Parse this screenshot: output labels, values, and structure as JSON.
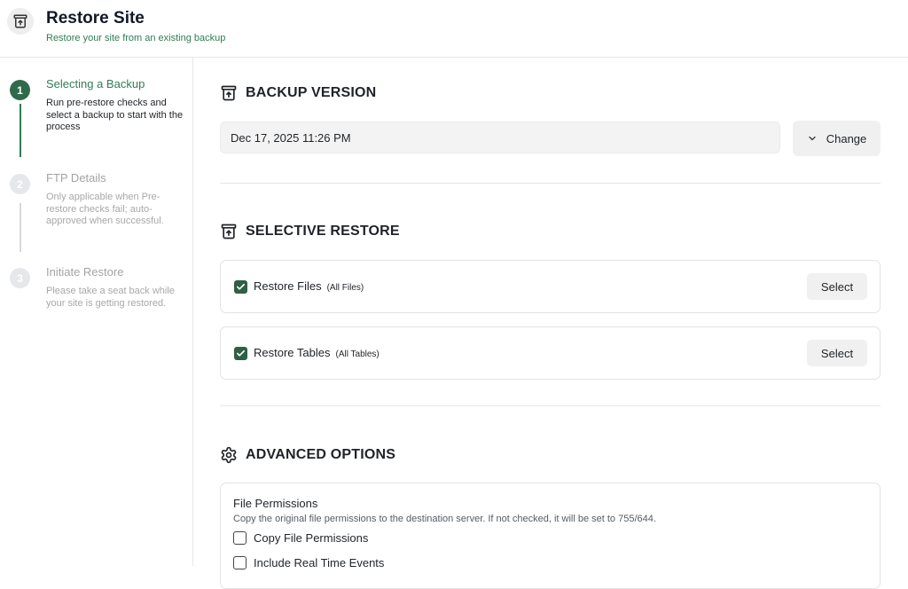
{
  "header": {
    "title": "Restore Site",
    "subtitle": "Restore your site from an existing backup",
    "icon": "archive-restore-icon"
  },
  "steps": [
    {
      "number": "1",
      "title": "Selecting a Backup",
      "description": "Run pre-restore checks and select a backup to start with the process",
      "state": "active"
    },
    {
      "number": "2",
      "title": "FTP Details",
      "description": "Only applicable when Pre-restore checks fail; auto-approved when successful.",
      "state": "inactive"
    },
    {
      "number": "3",
      "title": "Initiate Restore",
      "description": "Please take a seat back while your site is getting restored.",
      "state": "inactive"
    }
  ],
  "backup_version": {
    "heading": "BACKUP VERSION",
    "value": "Dec 17, 2025 11:26 PM",
    "change_label": "Change"
  },
  "selective_restore": {
    "heading": "SELECTIVE RESTORE",
    "items": [
      {
        "label": "Restore Files",
        "sub": "(All Files)",
        "checked": true,
        "button": "Select"
      },
      {
        "label": "Restore Tables",
        "sub": "(All Tables)",
        "checked": true,
        "button": "Select"
      }
    ]
  },
  "advanced_options": {
    "heading": "ADVANCED OPTIONS",
    "file_permissions": {
      "title": "File Permissions",
      "description": "Copy the original file permissions to the destination server. If not checked, it will be set to 755/644.",
      "options": [
        {
          "label": "Copy File Permissions",
          "checked": false
        },
        {
          "label": "Include Real Time Events",
          "checked": false
        }
      ]
    }
  },
  "colors": {
    "accent": "#2f7d54",
    "step_active": "#2f6b4b",
    "checkbox": "#2f5f46"
  }
}
